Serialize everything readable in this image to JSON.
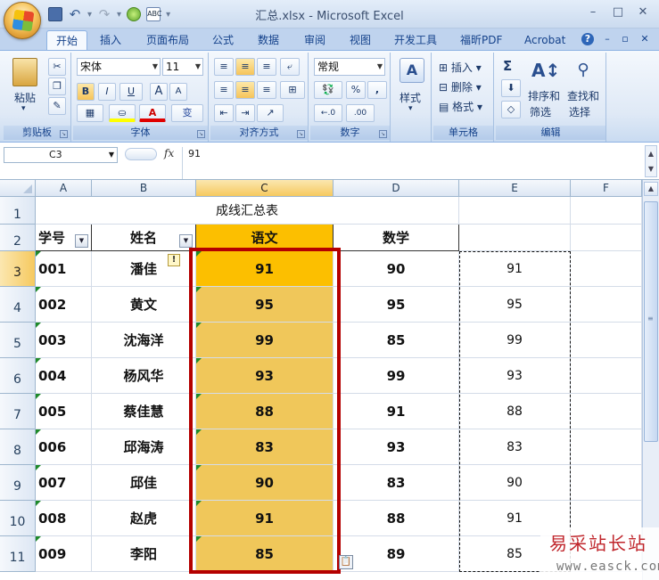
{
  "window": {
    "title": "汇总.xlsx - Microsoft Excel",
    "buttons": [
      "–",
      "□",
      "✕"
    ]
  },
  "tabs": [
    {
      "label": "开始",
      "active": true
    },
    {
      "label": "插入"
    },
    {
      "label": "页面布局"
    },
    {
      "label": "公式"
    },
    {
      "label": "数据"
    },
    {
      "label": "审阅"
    },
    {
      "label": "视图"
    },
    {
      "label": "开发工具"
    },
    {
      "label": "福昕PDF"
    },
    {
      "label": "Acrobat"
    }
  ],
  "ribbon": {
    "clipboard": {
      "title": "剪贴板",
      "paste": "粘贴"
    },
    "font": {
      "title": "字体",
      "font_name": "宋体",
      "font_size": "11",
      "bold": "B",
      "italic": "I",
      "underline": "U",
      "grow": "A",
      "shrink": "A",
      "wen": "变"
    },
    "alignment": {
      "title": "对齐方式"
    },
    "number": {
      "title": "数字",
      "format": "常规",
      "percent": "%",
      "comma": ",",
      "inc": "←.0",
      "dec": ".00"
    },
    "styles": {
      "label": "样式"
    },
    "cells": {
      "title": "单元格",
      "insert": "插入",
      "delete": "删除",
      "format": "格式"
    },
    "editing": {
      "title": "编辑",
      "sort": "排序和",
      "sort2": "筛选",
      "find": "查找和",
      "find2": "选择",
      "sigma": "Σ"
    }
  },
  "formula_bar": {
    "name_box": "C3",
    "fx": "fx",
    "value": "91"
  },
  "columns": [
    "A",
    "B",
    "C",
    "D",
    "E",
    "F"
  ],
  "rows": [
    "1",
    "2",
    "3",
    "4",
    "5",
    "6",
    "7",
    "8",
    "9",
    "10",
    "11"
  ],
  "sheet": {
    "title": "成线汇总表",
    "headers": [
      "学号",
      "姓名",
      "语文",
      "数学"
    ],
    "records": [
      {
        "id": "001",
        "name": "潘佳",
        "chinese": "91",
        "math": "90",
        "copy": "91"
      },
      {
        "id": "002",
        "name": "黄文",
        "chinese": "95",
        "math": "95",
        "copy": "95"
      },
      {
        "id": "003",
        "name": "沈海洋",
        "chinese": "99",
        "math": "85",
        "copy": "99"
      },
      {
        "id": "004",
        "name": "杨风华",
        "chinese": "93",
        "math": "99",
        "copy": "93"
      },
      {
        "id": "005",
        "name": "蔡佳慧",
        "chinese": "88",
        "math": "91",
        "copy": "88"
      },
      {
        "id": "006",
        "name": "邱海涛",
        "chinese": "83",
        "math": "93",
        "copy": "83"
      },
      {
        "id": "007",
        "name": "邱佳",
        "chinese": "90",
        "math": "83",
        "copy": "90"
      },
      {
        "id": "008",
        "name": "赵虎",
        "chinese": "91",
        "math": "88",
        "copy": "91"
      },
      {
        "id": "009",
        "name": "李阳",
        "chinese": "85",
        "math": "89",
        "copy": "85"
      }
    ]
  },
  "colors": {
    "selected_cell": "#fcbf00",
    "selection_fill": "#f0c75a",
    "highlight_border": "#b40000"
  },
  "watermark": {
    "cn": "易采站长站",
    "url": "www.easck.com"
  }
}
